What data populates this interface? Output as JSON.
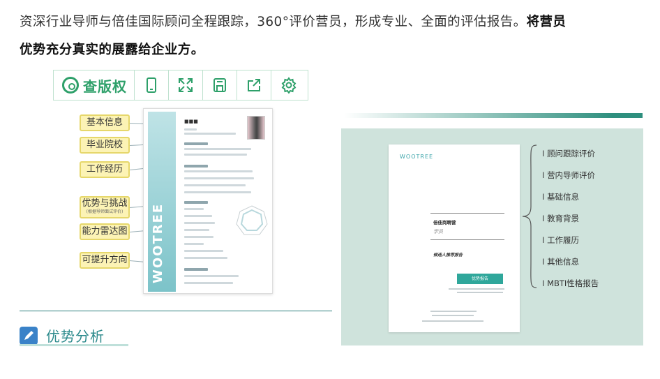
{
  "intro": {
    "text": "资深行业导师与倍佳国际顾问全程跟踪，360°评价营员，形成专业、全面的评估报告。",
    "bold_a": "将营员",
    "bold_b": "优势充分真实的展露给企业方。"
  },
  "toolbar": {
    "brand": "查版权",
    "buttons": [
      "tablet-icon",
      "expand-icon",
      "save-icon",
      "share-icon",
      "settings-icon"
    ],
    "accent": "#2ea06a"
  },
  "resume": {
    "brand": "WOOTREE",
    "callouts": [
      {
        "label": "基本信息"
      },
      {
        "label": "毕业院校"
      },
      {
        "label": "工作经历"
      },
      {
        "label": "优势与挑战",
        "sub": "(根据导师面试评价)"
      },
      {
        "label": "能力雷达图"
      },
      {
        "label": "可提升方向"
      }
    ]
  },
  "section": {
    "title": "优势分析",
    "color": "#2c8a8c"
  },
  "cover": {
    "logo": "WOOTREE",
    "title": "倍佳岗聘营",
    "signature": "学员",
    "subtitle": "候选人推荐报告",
    "button": "优势报告"
  },
  "toc": [
    "顾问跟踪评价",
    "营内导师评价",
    "基础信息",
    "教育背景",
    "工作履历",
    "其他信息",
    "MBTI性格报告"
  ]
}
